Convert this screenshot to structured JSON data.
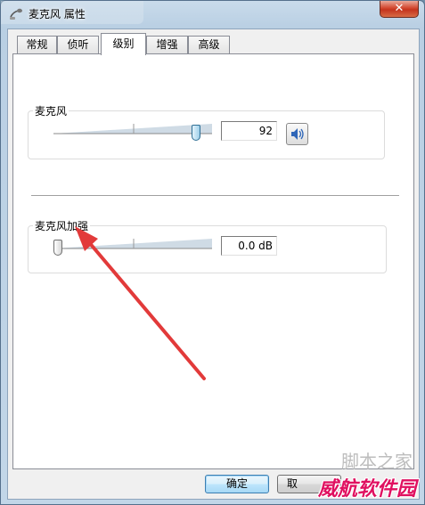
{
  "window": {
    "title": "麦克风 属性",
    "close_symbol": "✕"
  },
  "tabs": [
    {
      "label": "常规",
      "active": false
    },
    {
      "label": "侦听",
      "active": false
    },
    {
      "label": "级别",
      "active": true
    },
    {
      "label": "增强",
      "active": false
    },
    {
      "label": "高级",
      "active": false
    }
  ],
  "levels": {
    "microphone": {
      "label": "麦克风",
      "value": "92",
      "level": 0.92,
      "speaker_icon": "speaker-icon"
    },
    "boost": {
      "label": "麦克风加强",
      "value": "0.0 dB",
      "level": 0.0
    }
  },
  "buttons": {
    "ok": "确定",
    "cancel": "取"
  },
  "watermark": {
    "main": "威航软件园",
    "sub": "脚本之家"
  },
  "colors": {
    "arrow": "#e23a3a",
    "watermark": "#e01060",
    "accent": "#3c7fb1"
  }
}
